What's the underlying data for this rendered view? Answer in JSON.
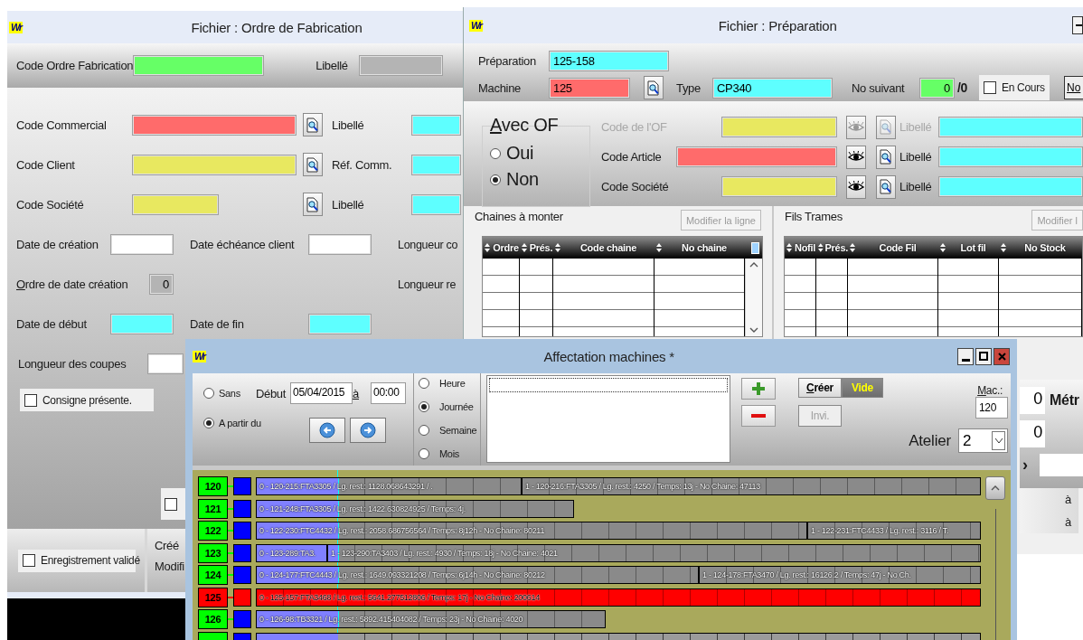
{
  "fabrication_window": {
    "logo": "Wr",
    "title": "Fichier : Ordre de Fabrication",
    "header": {
      "label": "Code Ordre Fabrication",
      "field": {
        "color": "#66ff66"
      },
      "side_label": "Libellé",
      "side_field": {
        "color": "#b4b4b4"
      }
    },
    "lookups": [
      {
        "label": "Code Commercial",
        "kind": "long",
        "field": {
          "color": "#ff6b6b"
        },
        "side_label": "Libellé",
        "side_field": {
          "color": "#5effff"
        }
      },
      {
        "label": "Code Client",
        "kind": "long",
        "field": {
          "color": "#e8e860"
        },
        "side_label": "Réf. Comm.",
        "side_field": {
          "color": "#5effff"
        }
      },
      {
        "label": "Code Société",
        "kind": "short",
        "field": {
          "color": "#e8e860"
        },
        "side_label": "Libellé",
        "side_field": {
          "color": "#5effff"
        }
      }
    ],
    "dates": [
      {
        "label": "Date de création",
        "mnemonic": false,
        "kind": "normal",
        "field": {
          "color": "#ffffff"
        },
        "mid_label": "Date échéance client",
        "mid_field": {
          "color": "#ffffff"
        },
        "right_label": "Longueur co"
      },
      {
        "label": "Ordre de date création",
        "mnemonic": true,
        "kind": "small",
        "field": {
          "color": "#b4b4b4",
          "value": "0"
        },
        "right_label": "Longueur re"
      },
      {
        "label": "Date de début",
        "mnemonic": false,
        "kind": "normal",
        "field": {
          "color": "#5effff"
        },
        "mid_label": "Date de fin",
        "mid_field": {
          "color": "#5effff"
        }
      }
    ],
    "coupes": {
      "label": "Longueur des coupes",
      "field": {
        "color": "#ffffff"
      }
    },
    "consigne": {
      "label": "Consigne présente.",
      "checked": false
    },
    "s_option": {
      "checked": false
    },
    "footer": {
      "validated": {
        "label": "Enregistrement validé",
        "checked": false
      },
      "created": "Créé",
      "modified": "Modifi"
    }
  },
  "preparation_window": {
    "logo": "Wr",
    "title": "Fichier : Préparation",
    "preparation": {
      "label": "Préparation",
      "value": "125-158",
      "color": "#5effff"
    },
    "machine": {
      "label": "Machine",
      "value": "125",
      "color": "#ff6b6b"
    },
    "type": {
      "label": "Type",
      "value": "CP340",
      "color": "#5effff"
    },
    "next_number": {
      "label": "No suivant",
      "value": "0",
      "color": "#66ff66",
      "total": "/0"
    },
    "en_cours": {
      "label": "En Cours",
      "checked": false
    },
    "no_button": "No",
    "avec_of": {
      "legend": "Avec OF",
      "options": [
        {
          "label": "Oui",
          "selected": false
        },
        {
          "label": "Non",
          "selected": true
        }
      ]
    },
    "codes": [
      {
        "label": "Code de l'OF",
        "disabled": true,
        "kind": "short",
        "field": {
          "color": "#e8e860"
        },
        "side_label": "Libellé",
        "side_field": {
          "color": "#5effff"
        }
      },
      {
        "label": "Code Article",
        "disabled": false,
        "kind": "long",
        "field": {
          "color": "#ff6b6b"
        },
        "side_label": "Libellé",
        "side_field": {
          "color": "#5effff"
        }
      },
      {
        "label": "Code Société",
        "disabled": false,
        "kind": "short",
        "field": {
          "color": "#e8e860"
        },
        "side_label": "Libellé",
        "side_field": {
          "color": "#5effff"
        }
      }
    ],
    "chaines": {
      "title": "Chaines à monter",
      "button": {
        "label": "Modifier la ligne",
        "disabled": true
      },
      "columns": [
        "Ordre",
        "Prés.",
        "Code chaine",
        "No chaine"
      ]
    },
    "fils": {
      "title": "Fils Trames",
      "button": {
        "label": "Modifier l",
        "disabled": true
      },
      "columns": [
        "Nofil",
        "Prés.",
        "Code Fil",
        "Lot fil",
        "No Stock"
      ]
    },
    "side": {
      "values": [
        "0",
        "0"
      ],
      "unit": "Métr",
      "chevron": "›",
      "to_labels": [
        "à",
        "à"
      ]
    }
  },
  "affectation_window": {
    "logo": "Wr",
    "title": "Affectation machines *",
    "modes": [
      {
        "label": "Sans",
        "selected": false
      },
      {
        "label": "A partir du",
        "selected": true
      }
    ],
    "start": {
      "label": "Début",
      "date": "05/04/2015",
      "to": "à",
      "time": "00:00"
    },
    "periods": [
      {
        "label": "Heure",
        "selected": false
      },
      {
        "label": "Journée",
        "selected": true
      },
      {
        "label": "Semaine",
        "selected": false
      },
      {
        "label": "Mois",
        "selected": false
      }
    ],
    "actions": [
      {
        "label": "Créer",
        "kind": "mnemonic"
      },
      {
        "label": "Vide",
        "kind": "highlight"
      },
      {
        "label": "Invi.",
        "kind": "disabled"
      }
    ],
    "machine": {
      "label": "Mac.:",
      "value": "120"
    },
    "atelier": {
      "label": "Atelier",
      "value": "2"
    },
    "rows": [
      {
        "machine": "120",
        "color": "#00ff00",
        "alert": false,
        "tasks": [
          {
            "label": "0 - 120-215:FTA3305 / Lg. rest.: 1128.068643291 / ."
          },
          {
            "label": "1 - 120-216:FTA3305 / Lg. rest.: 4250 / Temps: 13j - No Chaine: 47113"
          }
        ]
      },
      {
        "machine": "121",
        "color": "#00ff00",
        "alert": false,
        "tasks": [
          {
            "label": "0 - 121-248:FTA3305 / Lg. rest.: 1422.630824925 / Temps: 4j."
          }
        ]
      },
      {
        "machine": "122",
        "color": "#00ff00",
        "alert": false,
        "tasks": [
          {
            "label": "0 - 122-230:FTC4432 / Lg. rest.: 2058.686756564 / Temps: 8j12h - No Chaine: 80211"
          },
          {
            "label": "1 - 122-231:FTC4433 / Lg. rest.: 3116 / T."
          }
        ]
      },
      {
        "machine": "123",
        "color": "#00ff00",
        "alert": false,
        "tasks": [
          {
            "label": "0 - 123-289:TA3."
          },
          {
            "label": "1 - 123-290:TA3403 / Lg. rest.: 4930 / Temps: 18j - No Chaine: 4021"
          }
        ]
      },
      {
        "machine": "124",
        "color": "#00ff00",
        "alert": false,
        "tasks": [
          {
            "label": "0 - 124-177:FTC4443 / Lg. rest.: 1649.093321208 / Temps: 6j14h - No Chaine: 80212"
          },
          {
            "label": "1 - 124-178:FTA3470 / Lg. rest.: 16126.2 / Temps: 47j - No Ch."
          }
        ]
      },
      {
        "machine": "125",
        "color": "#ff0000",
        "alert": true,
        "tasks": [
          {
            "label": "0 - 125-157:FTA3468 / Lg. rest.: 5641.277512806 / Temps: 17j - No Chaine: 200614"
          }
        ]
      },
      {
        "machine": "126",
        "color": "#00ff00",
        "alert": false,
        "tasks": [
          {
            "label": "0 - 126-98:TB3321 / Lg. rest.: 5892.415404082 / Temps: 23j - No Chaine: 4020"
          }
        ]
      }
    ]
  }
}
